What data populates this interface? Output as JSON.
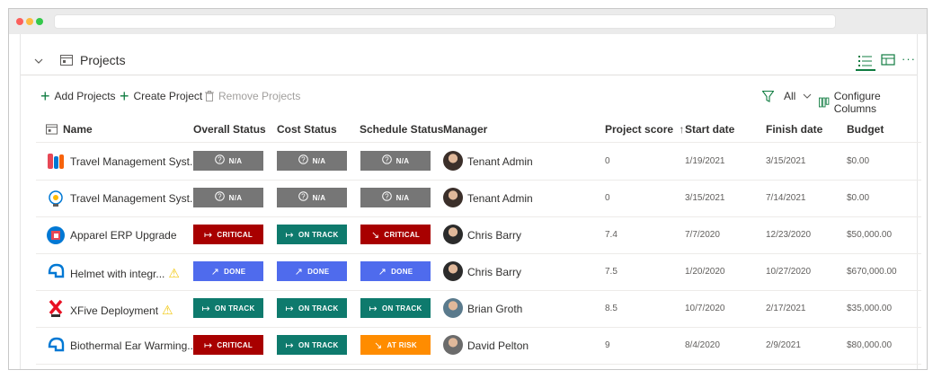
{
  "header": {
    "title": "Projects"
  },
  "toolbar": {
    "add_projects": "Add Projects",
    "create_project": "Create Project",
    "remove_projects": "Remove Projects",
    "filter_label": "All",
    "configure_columns": "Configure Columns"
  },
  "columns": {
    "name": "Name",
    "overall_status": "Overall Status",
    "cost_status": "Cost Status",
    "schedule_status": "Schedule Status",
    "manager": "Manager",
    "project_score": "Project score",
    "sort_indicator": "↑",
    "start_date": "Start date",
    "finish_date": "Finish date",
    "budget": "Budget"
  },
  "rows": [
    {
      "name": "Travel Management Syst...",
      "warning": false,
      "overall": "N/A",
      "cost": "N/A",
      "schedule": "N/A",
      "manager": "Tenant Admin",
      "score": "0",
      "start": "1/19/2021",
      "finish": "3/15/2021",
      "budget": "$0.00"
    },
    {
      "name": "Travel Management Syst...",
      "warning": false,
      "overall": "N/A",
      "cost": "N/A",
      "schedule": "N/A",
      "manager": "Tenant Admin",
      "score": "0",
      "start": "3/15/2021",
      "finish": "7/14/2021",
      "budget": "$0.00"
    },
    {
      "name": "Apparel ERP Upgrade",
      "warning": false,
      "overall": "CRITICAL",
      "cost": "ON TRACK",
      "schedule": "CRITICAL",
      "manager": "Chris Barry",
      "score": "7.4",
      "start": "7/7/2020",
      "finish": "12/23/2020",
      "budget": "$50,000.00"
    },
    {
      "name": "Helmet with integr...",
      "warning": true,
      "overall": "DONE",
      "cost": "DONE",
      "schedule": "DONE",
      "manager": "Chris Barry",
      "score": "7.5",
      "start": "1/20/2020",
      "finish": "10/27/2020",
      "budget": "$670,000.00"
    },
    {
      "name": "XFive Deployment",
      "warning": true,
      "overall": "ON TRACK",
      "cost": "ON TRACK",
      "schedule": "ON TRACK",
      "manager": "Brian Groth",
      "score": "8.5",
      "start": "10/7/2020",
      "finish": "2/17/2021",
      "budget": "$35,000.00"
    },
    {
      "name": "Biothermal Ear Warming...",
      "warning": false,
      "overall": "CRITICAL",
      "cost": "ON TRACK",
      "schedule": "AT RISK",
      "manager": "David Pelton",
      "score": "9",
      "start": "8/4/2020",
      "finish": "2/9/2021",
      "budget": "$80,000.00"
    }
  ],
  "colors": {
    "accent": "#107c41",
    "na": "#767676",
    "critical": "#a80000",
    "on_track": "#0e7a6d",
    "done": "#4f6bed",
    "at_risk": "#ff8c00",
    "warning": "#f2c811"
  },
  "icons": {
    "status_na": "question-circle-icon",
    "status_critical": "arrow-right-bar-icon",
    "status_on_track": "arrow-right-bar-icon",
    "status_done": "trending-up-icon",
    "status_at_risk": "trending-down-icon"
  }
}
